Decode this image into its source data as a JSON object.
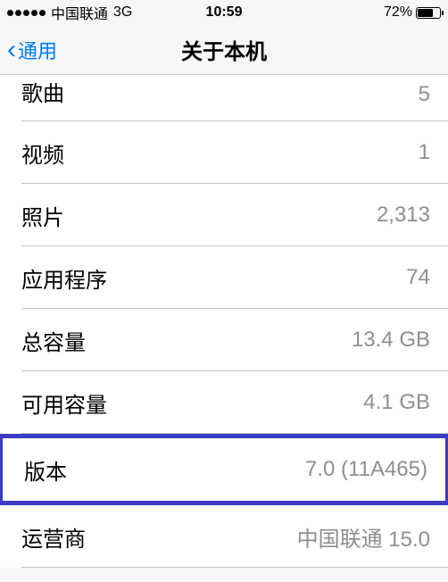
{
  "status_bar": {
    "carrier": "中国联通",
    "network": "3G",
    "time": "10:59",
    "battery_percent": "72%"
  },
  "nav": {
    "back_label": "通用",
    "title": "关于本机"
  },
  "rows": {
    "songs": {
      "label": "歌曲",
      "value": "5"
    },
    "videos": {
      "label": "视频",
      "value": "1"
    },
    "photos": {
      "label": "照片",
      "value": "2,313"
    },
    "apps": {
      "label": "应用程序",
      "value": "74"
    },
    "capacity": {
      "label": "总容量",
      "value": "13.4 GB"
    },
    "available": {
      "label": "可用容量",
      "value": "4.1 GB"
    },
    "version": {
      "label": "版本",
      "value": "7.0 (11A465)"
    },
    "carrier": {
      "label": "运营商",
      "value": "中国联通 15.0"
    }
  }
}
